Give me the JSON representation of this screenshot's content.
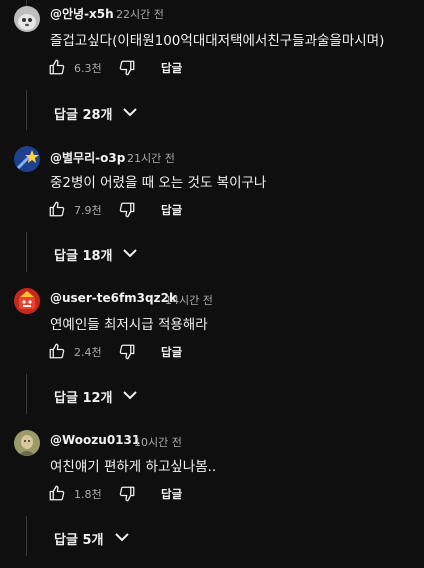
{
  "comments": [
    {
      "author": "@안녕-x5h",
      "time": "22시간 전",
      "text": "즐겁고싶다(이태원100억대대저택에서친구들과술을마시며)",
      "likes": "6.3천",
      "reply_label": "답글",
      "replies_label": "답글 28개",
      "avatar_icon": "gray-cat-avatar",
      "avatar_color": "#bdbdbd"
    },
    {
      "author": "@별무리-o3p",
      "time": "21시간 전",
      "text": "중2병이 어렸을 때 오는 것도 복이구나",
      "likes": "7.9천",
      "reply_label": "답글",
      "replies_label": "답글 18개",
      "avatar_icon": "shooting-star-avatar",
      "avatar_color": "#1f3f8f"
    },
    {
      "author": "@user-te6fm3qz2k",
      "time": "14시간 전",
      "text": "연예인들 최저시급 적용해라",
      "likes": "2.4천",
      "reply_label": "답글",
      "replies_label": "답글 12개",
      "avatar_icon": "red-character-avatar",
      "avatar_color": "#c6281c"
    },
    {
      "author": "@Woozu0131",
      "time": "10시간 전",
      "text": "여친얘기 편하게 하고싶나봄..",
      "likes": "1.8천",
      "reply_label": "답글",
      "replies_label": "답글 5개",
      "avatar_icon": "photo-avatar",
      "avatar_color": "#9a9a6a"
    }
  ]
}
